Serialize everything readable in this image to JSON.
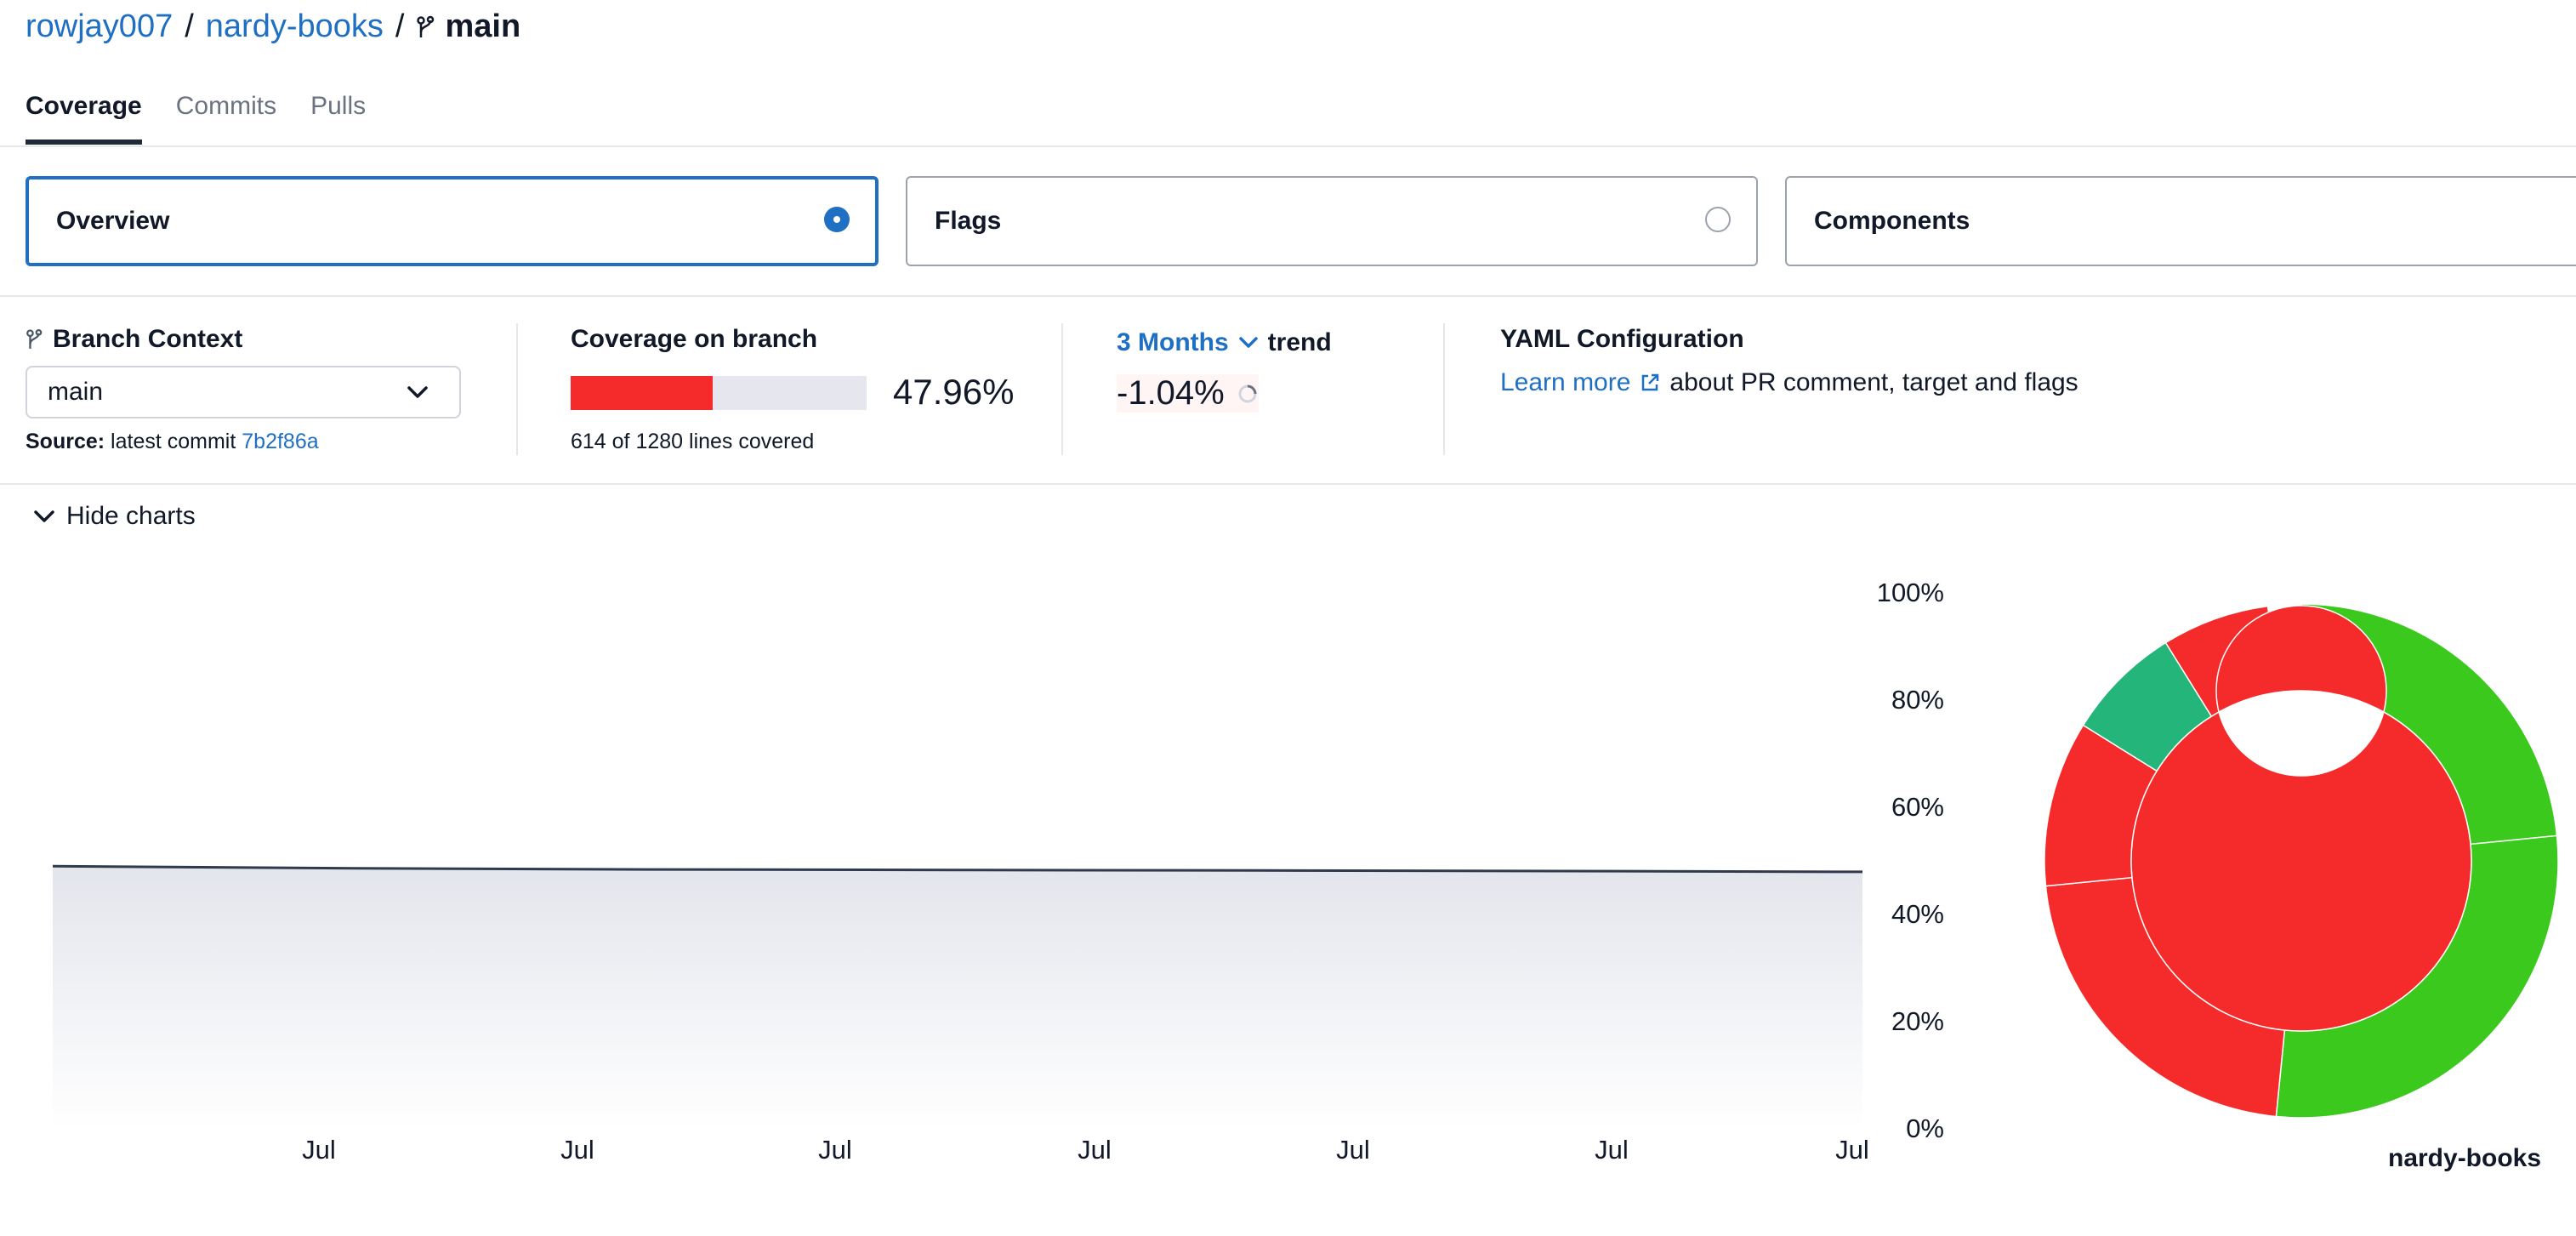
{
  "breadcrumb": {
    "owner": "rowjay007",
    "sep1": "/",
    "repo": "nardy-books",
    "sep2": "/",
    "branch": "main"
  },
  "tabs": [
    {
      "label": "Coverage",
      "active": true
    },
    {
      "label": "Commits",
      "active": false
    },
    {
      "label": "Pulls",
      "active": false
    }
  ],
  "views": [
    {
      "label": "Overview",
      "selected": true
    },
    {
      "label": "Flags",
      "selected": false
    },
    {
      "label": "Components",
      "selected": false
    }
  ],
  "branch_context": {
    "title": "Branch Context",
    "selected": "main",
    "source_label": "Source:",
    "source_text": "latest commit",
    "commit": "7b2f86a"
  },
  "coverage": {
    "title": "Coverage on branch",
    "percent_text": "47.96%",
    "percent": 47.96,
    "lines_text": "614 of 1280 lines covered"
  },
  "trend": {
    "period": "3 Months",
    "suffix": "trend",
    "value": "-1.04%"
  },
  "yaml": {
    "title": "YAML Configuration",
    "link": "Learn more",
    "text": "about PR comment, target and flags"
  },
  "charts_toggle": "Hide charts",
  "colors": {
    "accent": "#1f6fc3",
    "red": "#f52b2b",
    "green": "#3cc91d",
    "teal": "#24b57a"
  },
  "chart_data": [
    {
      "type": "area",
      "x": [
        "Jul",
        "Jul",
        "Jul",
        "Jul",
        "Jul",
        "Jul",
        "Jul"
      ],
      "series": [
        {
          "values": [
            49.0,
            48.6,
            48.4,
            48.3,
            48.2,
            48.1,
            47.96
          ]
        }
      ],
      "yticks": [
        "100%",
        "80%",
        "60%",
        "40%",
        "20%",
        "0%"
      ],
      "ylim": [
        0,
        100
      ],
      "grid": false
    },
    {
      "type": "pie",
      "title": "nardy-books",
      "inner_ring": [
        {
          "value": 100,
          "color": "#f52b2b"
        }
      ],
      "outer_ring": [
        {
          "value": 22.5,
          "color": "#3cc91d"
        },
        {
          "value": 27.0,
          "color": "#3cc91d"
        },
        {
          "value": 21.0,
          "color": "#f52b2b"
        },
        {
          "value": 10.0,
          "color": "#f52b2b"
        },
        {
          "value": 7.0,
          "color": "#24b57a"
        },
        {
          "value": 6.5,
          "color": "#f52b2b"
        },
        {
          "value": 2.0,
          "color": "#ffffff"
        }
      ]
    }
  ]
}
